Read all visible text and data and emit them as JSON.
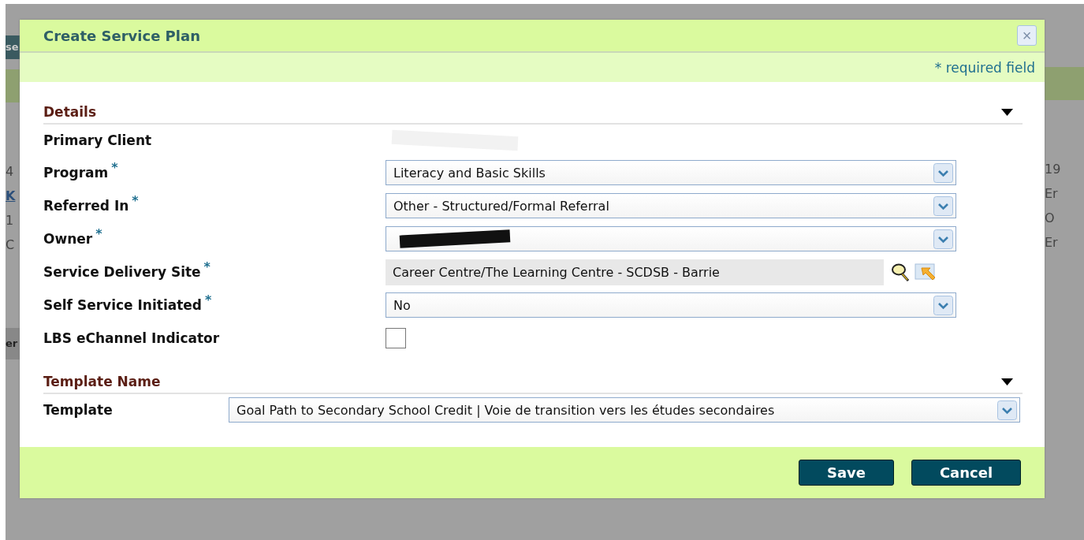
{
  "backdrop": {
    "left_texts": [
      {
        "text": "se",
        "kind": "header"
      },
      {
        "text": "4",
        "kind": "plain"
      },
      {
        "text": "K",
        "kind": "link"
      },
      {
        "text": "1",
        "kind": "plain"
      },
      {
        "text": "C",
        "kind": "plain"
      },
      {
        "text": "er",
        "kind": "bar"
      }
    ],
    "right_texts": [
      {
        "text": "19",
        "kind": "plain"
      },
      {
        "text": "Er",
        "kind": "plain"
      },
      {
        "text": "O",
        "kind": "plain"
      },
      {
        "text": "Er",
        "kind": "plain"
      }
    ]
  },
  "dialog": {
    "title": "Create Service Plan",
    "close": "×",
    "required_note": "* required field",
    "sections": [
      {
        "title": "Details",
        "expanded": true,
        "rows": [
          {
            "label": "Primary Client",
            "kind": "text",
            "redacted": true
          },
          {
            "label": "Program",
            "required_mark": "*",
            "kind": "select",
            "value": "Literacy and Basic Skills"
          },
          {
            "label": "Referred In",
            "required_mark": "*",
            "kind": "select",
            "value": "Other - Structured/Formal Referral"
          },
          {
            "label": "Owner",
            "required_mark": "*",
            "kind": "select",
            "redacted": true
          },
          {
            "label": "Service Delivery Site",
            "required_mark": "*",
            "kind": "lookup",
            "value": "Career Centre/The Learning Centre - SCDSB - Barrie"
          },
          {
            "label": "Self Service Initiated",
            "required_mark": "*",
            "kind": "select",
            "value": "No"
          },
          {
            "label": "LBS eChannel Indicator",
            "kind": "checkbox",
            "checked": false
          }
        ]
      },
      {
        "title": "Template Name",
        "expanded": true,
        "rows": [
          {
            "label": "Template",
            "kind": "wide-select",
            "value": "Goal Path to Secondary School Credit | Voie de transition vers les études secondaires"
          }
        ]
      }
    ],
    "buttons": [
      "Save",
      "Cancel"
    ]
  }
}
